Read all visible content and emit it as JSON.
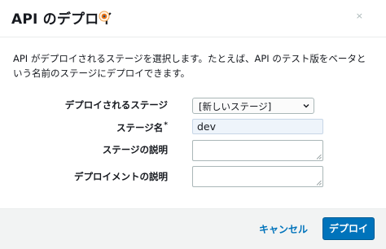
{
  "dialog": {
    "title": "API のデプロイ",
    "info_icon": "info-circle-icon",
    "close_icon": "close-icon",
    "close_glyph": "×",
    "description": "API がデプロイされるステージを選択します。たとえば、API のテスト版をベータという名前のステージにデプロイできます。"
  },
  "form": {
    "stage_select": {
      "label": "デプロイされるステージ",
      "value": "[新しいステージ]"
    },
    "stage_name": {
      "label": "ステージ名",
      "required_mark": "*",
      "value": "dev"
    },
    "stage_description": {
      "label": "ステージの説明",
      "value": ""
    },
    "deployment_description": {
      "label": "デプロイメントの説明",
      "value": ""
    }
  },
  "footer": {
    "cancel_label": "キャンセル",
    "deploy_label": "デプロイ"
  },
  "colors": {
    "accent": "#0073bb",
    "info_icon_orange": "#ec7211",
    "footer_bg": "#f2f3f3"
  }
}
